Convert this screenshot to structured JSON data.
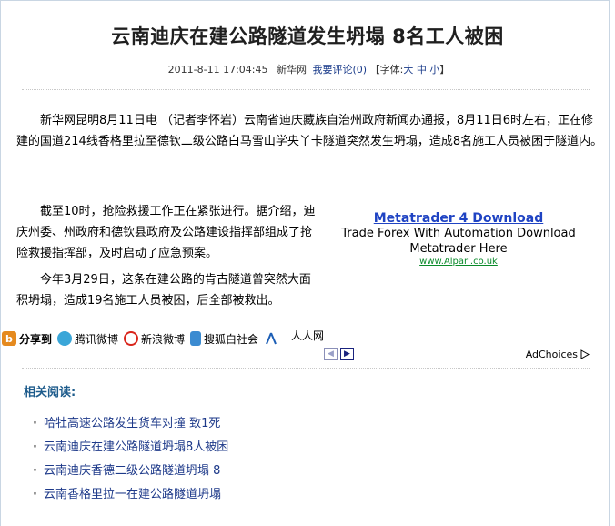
{
  "article": {
    "title": "云南迪庆在建公路隧道发生坍塌 8名工人被困",
    "meta": {
      "datetime": "2011-8-11 17:04:45",
      "source": "新华网",
      "comment_link": "我要评论(0)",
      "font_label": "【字体:",
      "font_large": "大",
      "font_medium": "中",
      "font_small": "小",
      "font_close": "】"
    },
    "paragraphs": [
      "新华网昆明8月11日电 （记者李怀岩）云南省迪庆藏族自治州政府新闻办通报，8月11日6时左右，正在修建的国道214线香格里拉至德钦二级公路白马雪山学央丫卡隧道突然发生坍塌，造成8名施工人员被困于隧道内。",
      "截至10时，抢险救援工作正在紧张进行。据介绍，迪庆州委、州政府和德钦县政府及公路建设指挥部组成了抢险救援指挥部，及时启动了应急预案。",
      "今年3月29日，这条在建公路的肯古隧道曾突然大面积坍塌，造成19名施工人员被困，后全部被救出。"
    ]
  },
  "ad": {
    "title": "Metatrader 4 Download",
    "line1": "Trade Forex With Automation Download",
    "line2": "Metatrader Here",
    "url": "www.Alpari.co.uk",
    "choices": "AdChoices"
  },
  "share": {
    "label": "分享到",
    "items": [
      "腾讯微博",
      "新浪微博",
      "搜狐白社会",
      "人人网"
    ]
  },
  "related": {
    "title": "相关阅读:",
    "items": [
      "哈牡高速公路发生货车对撞 致1死",
      "云南迪庆在建公路隧道坍塌8人被困",
      "云南迪庆香德二级公路隧道坍塌 8",
      "云南香格里拉一在建公路隧道坍塌"
    ]
  },
  "colors": {
    "link": "#1e3a8a",
    "related_title": "#1e5c8c",
    "ad_title": "#1f43c3",
    "ad_url": "#0a8a2a"
  }
}
